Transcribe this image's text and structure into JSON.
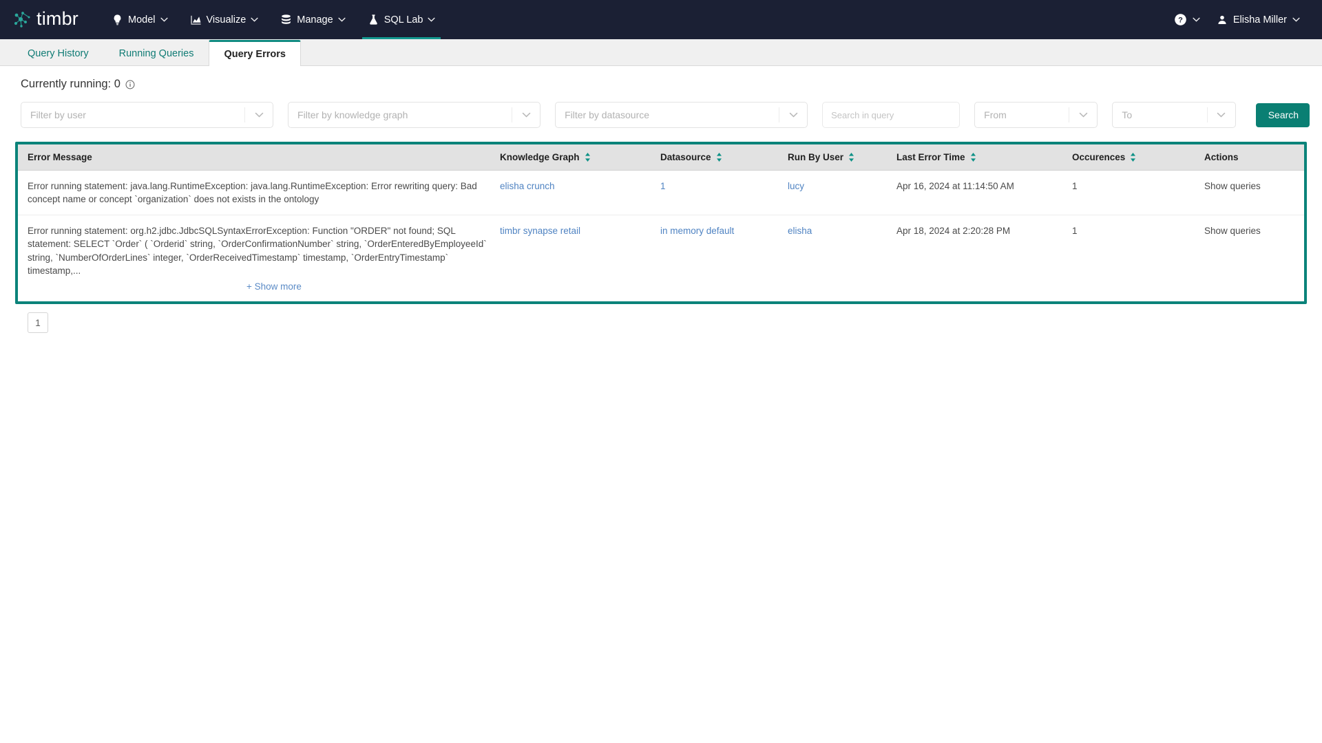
{
  "header": {
    "brand": "timbr",
    "brand_icon": "timbr-graph-logo-icon",
    "nav": [
      {
        "label": "Model",
        "icon": "lightbulb-icon",
        "active": false
      },
      {
        "label": "Visualize",
        "icon": "chart-icon",
        "active": false
      },
      {
        "label": "Manage",
        "icon": "database-icon",
        "active": false
      },
      {
        "label": "SQL Lab",
        "icon": "flask-icon",
        "active": true
      }
    ],
    "help_icon": "question-circle-icon",
    "user_icon": "user-icon",
    "user_name": "Elisha Miller",
    "caret_icon": "chevron-down-icon"
  },
  "tabs": [
    {
      "label": "Query History",
      "active": false
    },
    {
      "label": "Running Queries",
      "active": false
    },
    {
      "label": "Query Errors",
      "active": true
    }
  ],
  "status": {
    "running_label": "Currently running: 0",
    "info_icon": "info-circle-icon"
  },
  "filters": {
    "user_placeholder": "Filter by user",
    "knowledge_graph_placeholder": "Filter by knowledge graph",
    "datasource_placeholder": "Filter by datasource",
    "query_search_placeholder": "Search in query",
    "query_search_value": "",
    "from_placeholder": "From",
    "to_placeholder": "To",
    "search_button": "Search",
    "dropdown_icon": "chevron-down-icon"
  },
  "table": {
    "columns": [
      {
        "label": "Error Message",
        "sortable": false
      },
      {
        "label": "Knowledge Graph",
        "sortable": true
      },
      {
        "label": "Datasource",
        "sortable": true
      },
      {
        "label": "Run By User",
        "sortable": true
      },
      {
        "label": "Last Error Time",
        "sortable": true
      },
      {
        "label": "Occurences",
        "sortable": true
      },
      {
        "label": "Actions",
        "sortable": false
      }
    ],
    "sort_icon": "sort-arrows-icon",
    "rows": [
      {
        "message": "Error running statement: java.lang.RuntimeException: java.lang.RuntimeException: Error rewriting query: Bad concept name or concept `organization` does not exists in the ontology",
        "knowledge_graph": "elisha crunch",
        "datasource": "1",
        "run_by_user": "lucy",
        "last_error_time": "Apr 16, 2024 at 11:14:50 AM",
        "occurences": "1",
        "action": "Show queries",
        "show_more": false
      },
      {
        "message": "Error running statement: org.h2.jdbc.JdbcSQLSyntaxErrorException: Function \"ORDER\" not found; SQL statement: SELECT `Order` ( `Orderid` string, `OrderConfirmationNumber` string, `OrderEnteredByEmployeeId` string, `NumberOfOrderLines` integer, `OrderReceivedTimestamp` timestamp, `OrderEntryTimestamp` timestamp,...",
        "knowledge_graph": "timbr synapse retail",
        "datasource": "in memory default",
        "run_by_user": "elisha",
        "last_error_time": "Apr 18, 2024 at 2:20:28 PM",
        "occurences": "1",
        "action": "Show queries",
        "show_more": true
      }
    ],
    "show_more_label": "+ Show more"
  },
  "pagination": {
    "pages": [
      "1"
    ],
    "current": "1"
  },
  "colors": {
    "nav_bg": "#1b2034",
    "accent": "#0b837a",
    "link": "#4f83c2",
    "tab_active_border": "#0f8a80"
  }
}
